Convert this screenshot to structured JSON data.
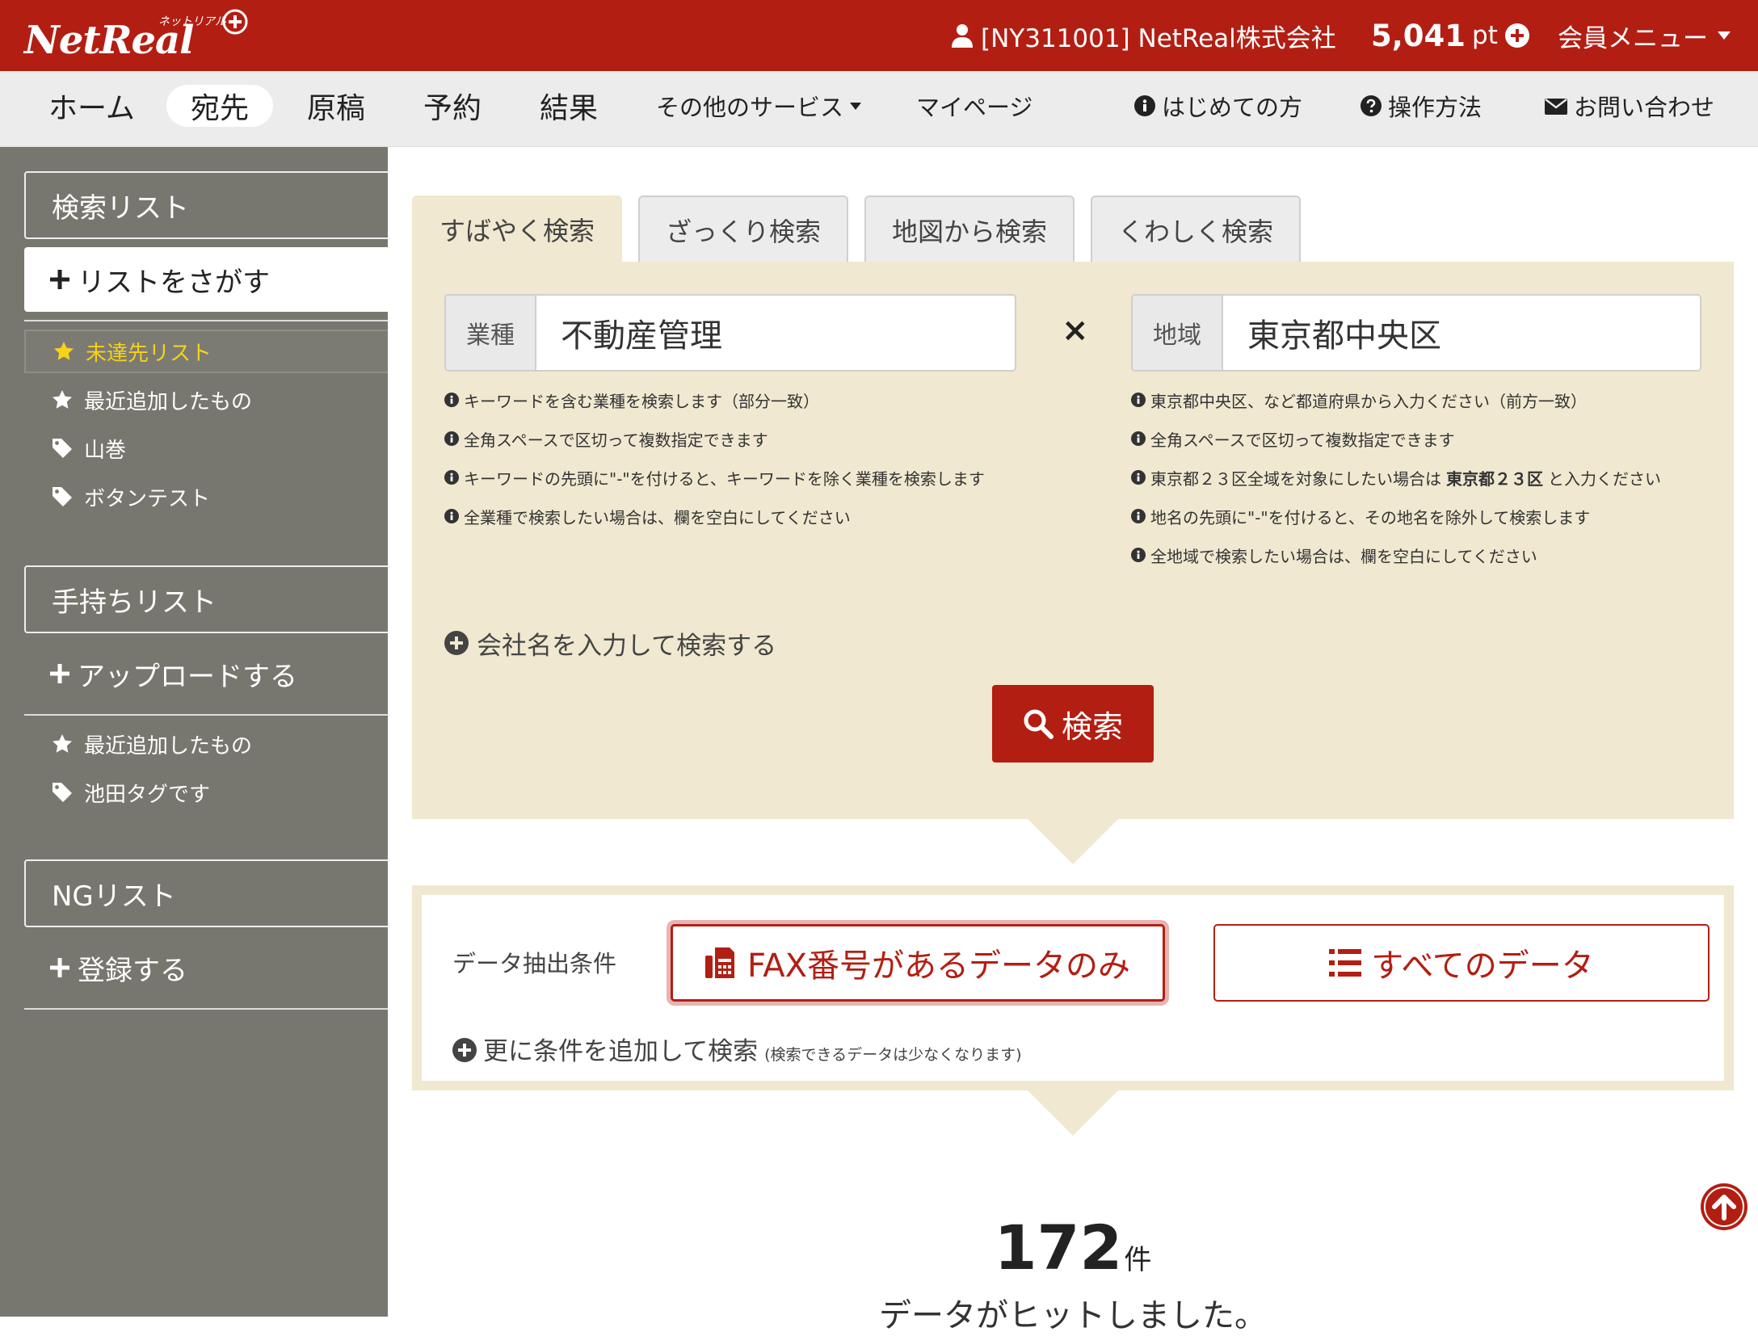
{
  "header": {
    "logo_text": "NetReal",
    "logo_kana": "ネットリアル",
    "account": "[NY311001] NetReal株式会社",
    "points_value": "5,041",
    "points_unit": "pt",
    "member_menu": "会員メニュー",
    "brand_color": "#b31e13"
  },
  "nav": {
    "home": "ホーム",
    "destination": "宛先",
    "manuscript": "原稿",
    "reservation": "予約",
    "results": "結果",
    "other_services": "その他のサービス",
    "mypage": "マイページ",
    "first_time": "はじめての方",
    "how_to": "操作方法",
    "contact": "お問い合わせ"
  },
  "sidebar": {
    "search_list": {
      "title": "検索リスト",
      "add": "リストをさがす",
      "items": [
        {
          "label": "未達先リスト",
          "icon": "star-icon"
        },
        {
          "label": "最近追加したもの",
          "icon": "star-icon"
        },
        {
          "label": "山巻",
          "icon": "tag-icon"
        },
        {
          "label": "ボタンテスト",
          "icon": "tag-icon"
        }
      ]
    },
    "own_list": {
      "title": "手持ちリスト",
      "add": "アップロードする",
      "items": [
        {
          "label": "最近追加したもの",
          "icon": "star-icon"
        },
        {
          "label": "池田タグです",
          "icon": "tag-icon"
        }
      ]
    },
    "ng_list": {
      "title": "NGリスト",
      "add": "登録する"
    }
  },
  "tabs": [
    "すばやく検索",
    "ざっくり検索",
    "地図から検索",
    "くわしく検索"
  ],
  "search": {
    "industry_label": "業種",
    "industry_value": "不動産管理",
    "times": "×",
    "region_label": "地域",
    "region_value": "東京都中央区",
    "industry_hints": [
      "キーワードを含む業種を検索します（部分一致）",
      "全角スペースで区切って複数指定できます",
      "キーワードの先頭に\"-\"を付けると、キーワードを除く業種を検索します",
      "全業種で検索したい場合は、欄を空白にしてください"
    ],
    "region_hints": [
      "東京都中央区、など都道府県から入力ください（前方一致）",
      "全角スペースで区切って複数指定できます",
      "東京都２３区全域を対象にしたい場合は",
      "地名の先頭に\"-\"を付けると、その地名を除外して検索します",
      "全地域で検索したい場合は、欄を空白にしてください"
    ],
    "region_hint_bold": "東京都２３区",
    "region_hint_suffix": "と入力ください",
    "company_search": "会社名を入力して検索する",
    "search_button": "検索"
  },
  "conditions": {
    "label": "データ抽出条件",
    "fax_only": "FAX番号があるデータのみ",
    "all_data": "すべてのデータ",
    "more": "更に条件を追加して検索",
    "more_note": "(検索できるデータは少なくなります)"
  },
  "result": {
    "count": "172",
    "unit": "件",
    "message": "データがヒットしました。"
  }
}
